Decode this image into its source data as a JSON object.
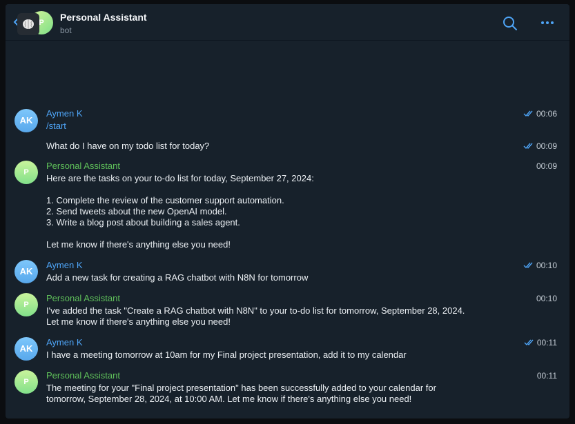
{
  "header": {
    "title": "Personal Assistant",
    "subtitle": "bot",
    "avatar_initial": "P"
  },
  "messages": [
    {
      "sender": "Aymen K",
      "avatar": "AK",
      "text": "/start",
      "time": "00:06"
    },
    {
      "text": "What do I have on my todo list for today?",
      "time": "00:09"
    },
    {
      "sender": "Personal Assistant",
      "avatar": "P",
      "text": "Here are the tasks on your to-do list for today, September 27, 2024:\n\n1. Complete the review of the customer support automation.\n2. Send tweets about the new OpenAI model.\n3. Write a blog post about building a sales agent.\n\nLet me know if there's anything else you need!",
      "time": "00:09"
    },
    {
      "sender": "Aymen K",
      "avatar": "AK",
      "text": "Add a new task for creating a RAG chatbot with N8N for tomorrow",
      "time": "00:10"
    },
    {
      "sender": "Personal Assistant",
      "avatar": "P",
      "text": "I've added the task \"Create a RAG chatbot with N8N\" to your to-do list for tomorrow, September 28, 2024.\nLet me know if there's anything else you need!",
      "time": "00:10"
    },
    {
      "sender": "Aymen K",
      "avatar": "AK",
      "text": "I have a meeting tomorrow at 10am for my Final project presentation, add it to my calendar",
      "time": "00:11"
    },
    {
      "sender": "Personal Assistant",
      "avatar": "P",
      "text": "The meeting for your \"Final project presentation\" has been successfully added to your calendar for\ntomorrow, September 28, 2024, at 10:00 AM. Let me know if there's anything else you need!",
      "time": "00:11"
    }
  ],
  "colors": {
    "background": "#17212b",
    "user_name": "#4ea4f6",
    "bot_name": "#5fc05a",
    "accent": "#4ea4f6"
  }
}
